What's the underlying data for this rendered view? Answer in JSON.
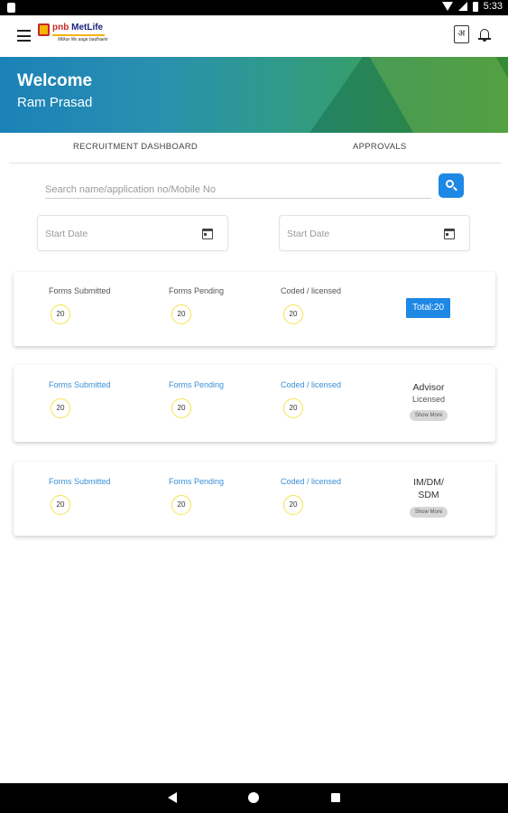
{
  "status_bar": {
    "time": "5:33"
  },
  "app_bar": {
    "logo_brand_pnb": "pnb",
    "logo_brand_metlife": "MetLife",
    "logo_tagline": "Milkar life aage badhaein",
    "hindi_icon_glyph": "अ"
  },
  "banner": {
    "title": "Welcome",
    "name": "Ram Prasad"
  },
  "tabs": [
    {
      "label": "RECRUITMENT DASHBOARD"
    },
    {
      "label": "APPROVALS"
    }
  ],
  "search": {
    "placeholder": "Search name/application no/Mobile No"
  },
  "date_filters": {
    "start_placeholder": "Start Date",
    "end_placeholder": "Start Date"
  },
  "cards": [
    {
      "stats": [
        {
          "label": "Forms Submitted",
          "value": "20"
        },
        {
          "label": "Forms Pending",
          "value": "20"
        },
        {
          "label": "Coded / licensed",
          "value": "20"
        }
      ],
      "total": "Total:20"
    },
    {
      "stats": [
        {
          "label": "Forms Submitted",
          "value": "20"
        },
        {
          "label": "Forms Pending",
          "value": "20"
        },
        {
          "label": "Coded / licensed",
          "value": "20"
        }
      ],
      "role_title": "Advisor",
      "role_sub": "Licensed",
      "show_more": "Show More"
    },
    {
      "stats": [
        {
          "label": "Forms Submitted",
          "value": "20"
        },
        {
          "label": "Forms Pending",
          "value": "20"
        },
        {
          "label": "Coded / licensed",
          "value": "20"
        }
      ],
      "role_title_line1": "IM/DM/",
      "role_title_line2": "SDM",
      "show_more": "Show More"
    }
  ],
  "colors": {
    "accent_blue": "#1e88e5",
    "banner_start": "#1a82b8",
    "banner_end": "#4aa63a",
    "stat_circle": "#f3e34a"
  }
}
